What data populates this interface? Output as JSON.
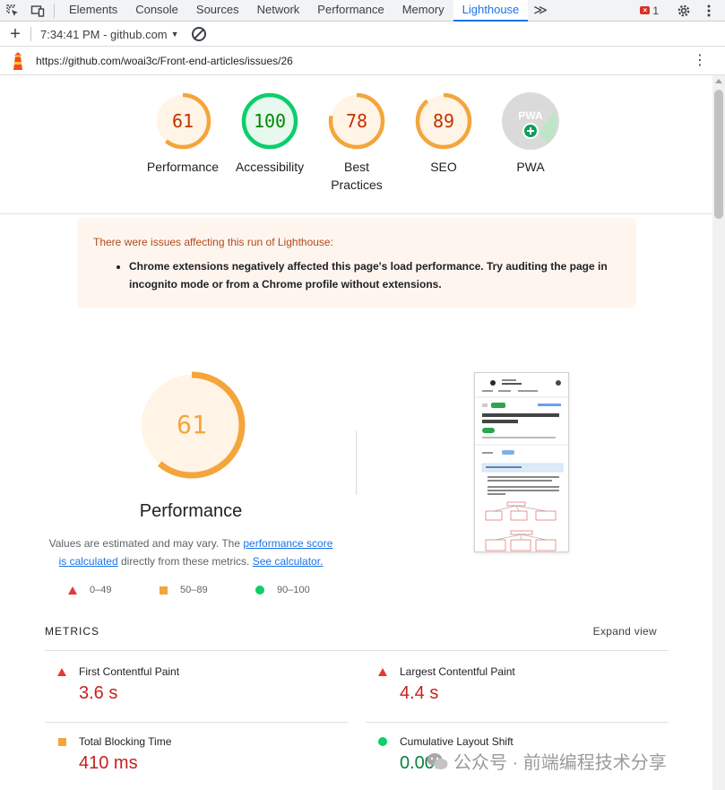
{
  "devtools": {
    "tabs": [
      {
        "label": "Elements"
      },
      {
        "label": "Console"
      },
      {
        "label": "Sources"
      },
      {
        "label": "Network"
      },
      {
        "label": "Performance"
      },
      {
        "label": "Memory"
      },
      {
        "label": "Lighthouse"
      }
    ],
    "more_tabs": "≫",
    "error_count": "1"
  },
  "toolbar": {
    "report_label": "7:34:41 PM - github.com"
  },
  "url": "https://github.com/woai3c/Front-end-articles/issues/26",
  "gauges": [
    {
      "score": "61",
      "label": "Performance",
      "value": 61,
      "color": "#f4a53b"
    },
    {
      "score": "100",
      "label": "Accessibility",
      "value": 100,
      "color": "#0cce6b"
    },
    {
      "score": "78",
      "label": "Best Practices",
      "value": 78,
      "color": "#f4a53b"
    },
    {
      "score": "89",
      "label": "SEO",
      "value": 89,
      "color": "#f4a53b"
    },
    {
      "score": "",
      "label": "PWA",
      "value": null,
      "color": "#9e9e9e"
    }
  ],
  "pwa_badge": "PWA",
  "warning": {
    "title": "There were issues affecting this run of Lighthouse:",
    "items": [
      "Chrome extensions negatively affected this page's load performance. Try auditing the page in incognito mode or from a Chrome profile without extensions."
    ]
  },
  "performance": {
    "score": "61",
    "value": 61,
    "title": "Performance",
    "desc_prefix": "Values are estimated and may vary. The ",
    "link1": "performance score",
    "link1b": "is calculated",
    "desc_mid": " directly from these metrics. ",
    "link2": "See calculator."
  },
  "legend": [
    {
      "range": "0–49",
      "shape": "triangle",
      "color": "#e53935"
    },
    {
      "range": "50–89",
      "shape": "square",
      "color": "#f4a53b"
    },
    {
      "range": "90–100",
      "shape": "circle",
      "color": "#0cce6b"
    }
  ],
  "metrics": {
    "title": "METRICS",
    "expand": "Expand view",
    "items": [
      {
        "name": "First Contentful Paint",
        "value": "3.6 s",
        "status": "fail"
      },
      {
        "name": "Largest Contentful Paint",
        "value": "4.4 s",
        "status": "fail"
      },
      {
        "name": "Total Blocking Time",
        "value": "410 ms",
        "status": "average"
      },
      {
        "name": "Cumulative Layout Shift",
        "value": "0.001",
        "status": "pass"
      }
    ]
  },
  "watermark": "公众号 · 前端编程技术分享",
  "colors": {
    "accent": "#1a73e8",
    "fail": "#e53935",
    "average": "#f4a53b",
    "pass": "#0cce6b"
  }
}
